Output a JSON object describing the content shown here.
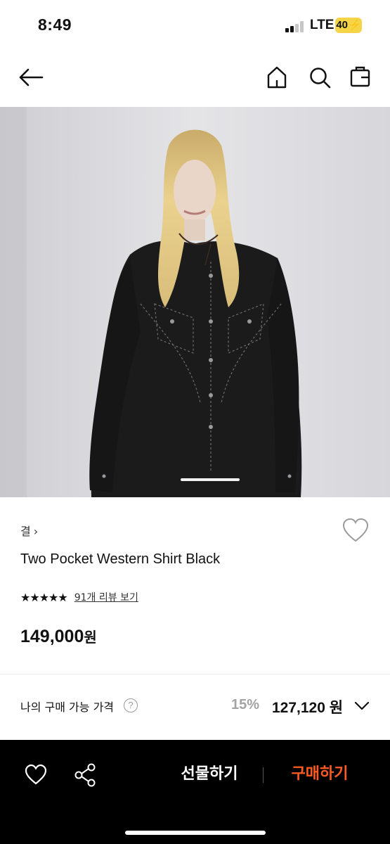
{
  "status": {
    "time": "8:49",
    "network": "LTE",
    "battery": "40"
  },
  "header": {
    "icons": [
      "back-arrow-icon",
      "home-icon",
      "search-icon",
      "shopping-bag-icon"
    ]
  },
  "product": {
    "brand": "결",
    "brand_chevron": "›",
    "title": "Two Pocket Western Shirt Black",
    "stars": "★★★★★",
    "review_link": "91개 리뷰 보기",
    "price": "149,000",
    "price_unit": "원",
    "image": {
      "description_colors": {
        "wall": "#dcdcdf",
        "shirt": "#1c1c1d",
        "hair": "#e6cf8c"
      },
      "slide_indicator": "active"
    }
  },
  "my_price": {
    "label": "나의 구매 가능 가격",
    "help": "?",
    "discount": "15%",
    "price": "127,120 원"
  },
  "bottom_bar": {
    "gift_label": "선물하기",
    "buy_label": "구매하기",
    "buy_color": "#ff5a1f"
  }
}
